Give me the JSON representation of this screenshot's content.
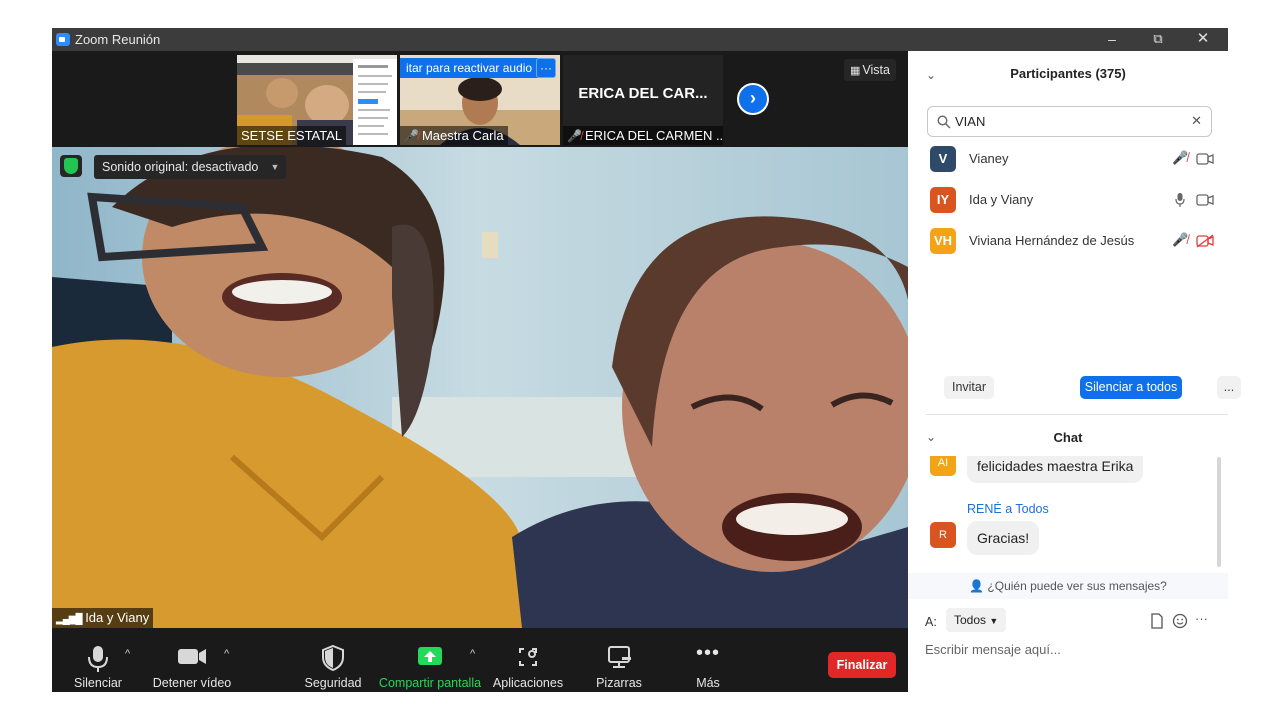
{
  "window": {
    "title": "Zoom Reunión",
    "minimize": "–",
    "restore": "⧉",
    "close": "✕"
  },
  "view_button": {
    "label": "Vista"
  },
  "thumbnails": [
    {
      "name": "SETSE ESTATAL",
      "muted": false
    },
    {
      "name": "Maestra Carla",
      "muted": true,
      "banner": "itar para reactivar audio",
      "banner_more": "···"
    },
    {
      "name": "ERICA DEL CARMEN ...",
      "muted": true,
      "display_name": "ERICA DEL CAR..."
    }
  ],
  "main_video": {
    "audio_badge": "Sonido original: desactivado",
    "speaker": "Ida y Viany"
  },
  "toolbar": {
    "mute": "Silenciar",
    "video": "Detener vídeo",
    "security": "Seguridad",
    "share": "Compartir pantalla",
    "apps": "Aplicaciones",
    "whiteboards": "Pizarras",
    "more": "Más",
    "end": "Finalizar"
  },
  "participants": {
    "header": "Participantes (375)",
    "search_value": "VIAN",
    "list": [
      {
        "initials": "V",
        "name": "Vianey",
        "color": "#2f4a68",
        "mic": "muted",
        "video": "on"
      },
      {
        "initials": "IY",
        "name": "Ida y Viany",
        "color": "#d9541e",
        "mic": "on",
        "video": "on"
      },
      {
        "initials": "VH",
        "name": "Viviana Hernández de Jesús",
        "color": "#f2a316",
        "mic": "muted",
        "video": "off"
      }
    ],
    "invite": "Invitar",
    "mute_all": "Silenciar a todos",
    "more": "..."
  },
  "chat": {
    "header": "Chat",
    "messages": [
      {
        "avatar": "AI",
        "avatar_color": "#f2a316",
        "text": "felicidades maestra Erika"
      },
      {
        "sender": "RENÉ a Todos",
        "avatar": "R",
        "avatar_color": "#d9541e",
        "text": "Gracias!"
      }
    ],
    "who_can_see": "¿Quién puede ver sus mensajes?",
    "to_label": "A:",
    "to_value": "Todos",
    "placeholder": "Escribir mensaje aquí...",
    "more": "···"
  },
  "colors": {
    "accent": "#0e71eb",
    "end": "#e02828",
    "share": "#23d959",
    "muted": "#e03e3e"
  }
}
